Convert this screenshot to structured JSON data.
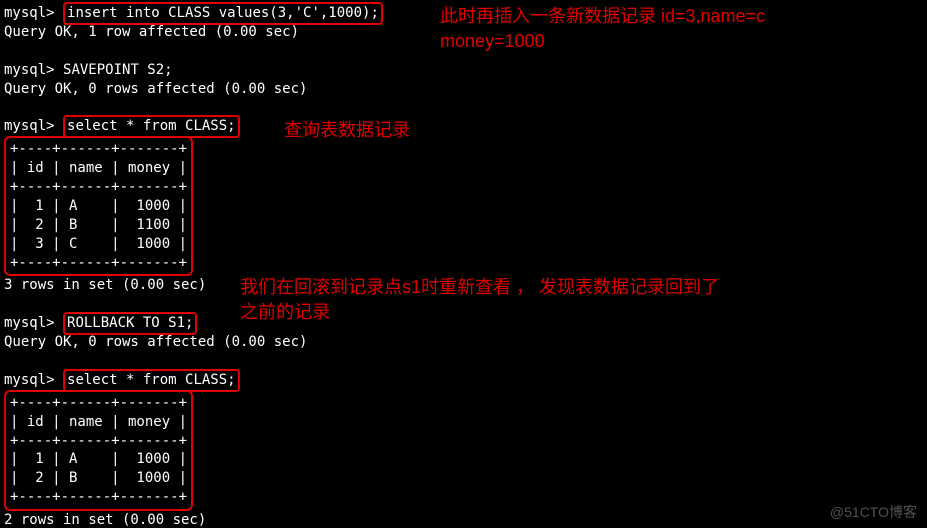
{
  "prompt": "mysql>",
  "cmds": {
    "insert": "insert into CLASS values(3,'C',1000);",
    "ok1": "Query OK, 1 row affected (0.00 sec)",
    "savepoint": "SAVEPOINT S2;",
    "ok0": "Query OK, 0 rows affected (0.00 sec)",
    "select": "select * from CLASS;",
    "rollback": "ROLLBACK TO S1;",
    "set3": "3 rows in set (0.00 sec)",
    "set2": "2 rows in set (0.00 sec)"
  },
  "table1": {
    "header": "| id | name | money |",
    "sep": "+----+------+-------+",
    "rows": [
      "|  1 | A    |  1000 |",
      "|  2 | B    |  1100 |",
      "|  3 | C    |  1000 |"
    ]
  },
  "table2": {
    "header": "| id | name | money |",
    "sep": "+----+------+-------+",
    "rows": [
      "|  1 | A    |  1000 |",
      "|  2 | B    |  1000 |"
    ]
  },
  "anno": {
    "a1": "此时再插入一条新数据记录 id=3,name=c\nmoney=1000",
    "a2": "查询表数据记录",
    "a3": "我们在回滚到记录点s1时重新查看 ， 发现表数据记录回到了\n之前的记录"
  },
  "watermark": "@51CTO博客",
  "chart_data": [
    {
      "type": "table",
      "title": "CLASS (after insert)",
      "columns": [
        "id",
        "name",
        "money"
      ],
      "rows": [
        [
          1,
          "A",
          1000
        ],
        [
          2,
          "B",
          1100
        ],
        [
          3,
          "C",
          1000
        ]
      ]
    },
    {
      "type": "table",
      "title": "CLASS (after ROLLBACK TO S1)",
      "columns": [
        "id",
        "name",
        "money"
      ],
      "rows": [
        [
          1,
          "A",
          1000
        ],
        [
          2,
          "B",
          1000
        ]
      ]
    }
  ]
}
